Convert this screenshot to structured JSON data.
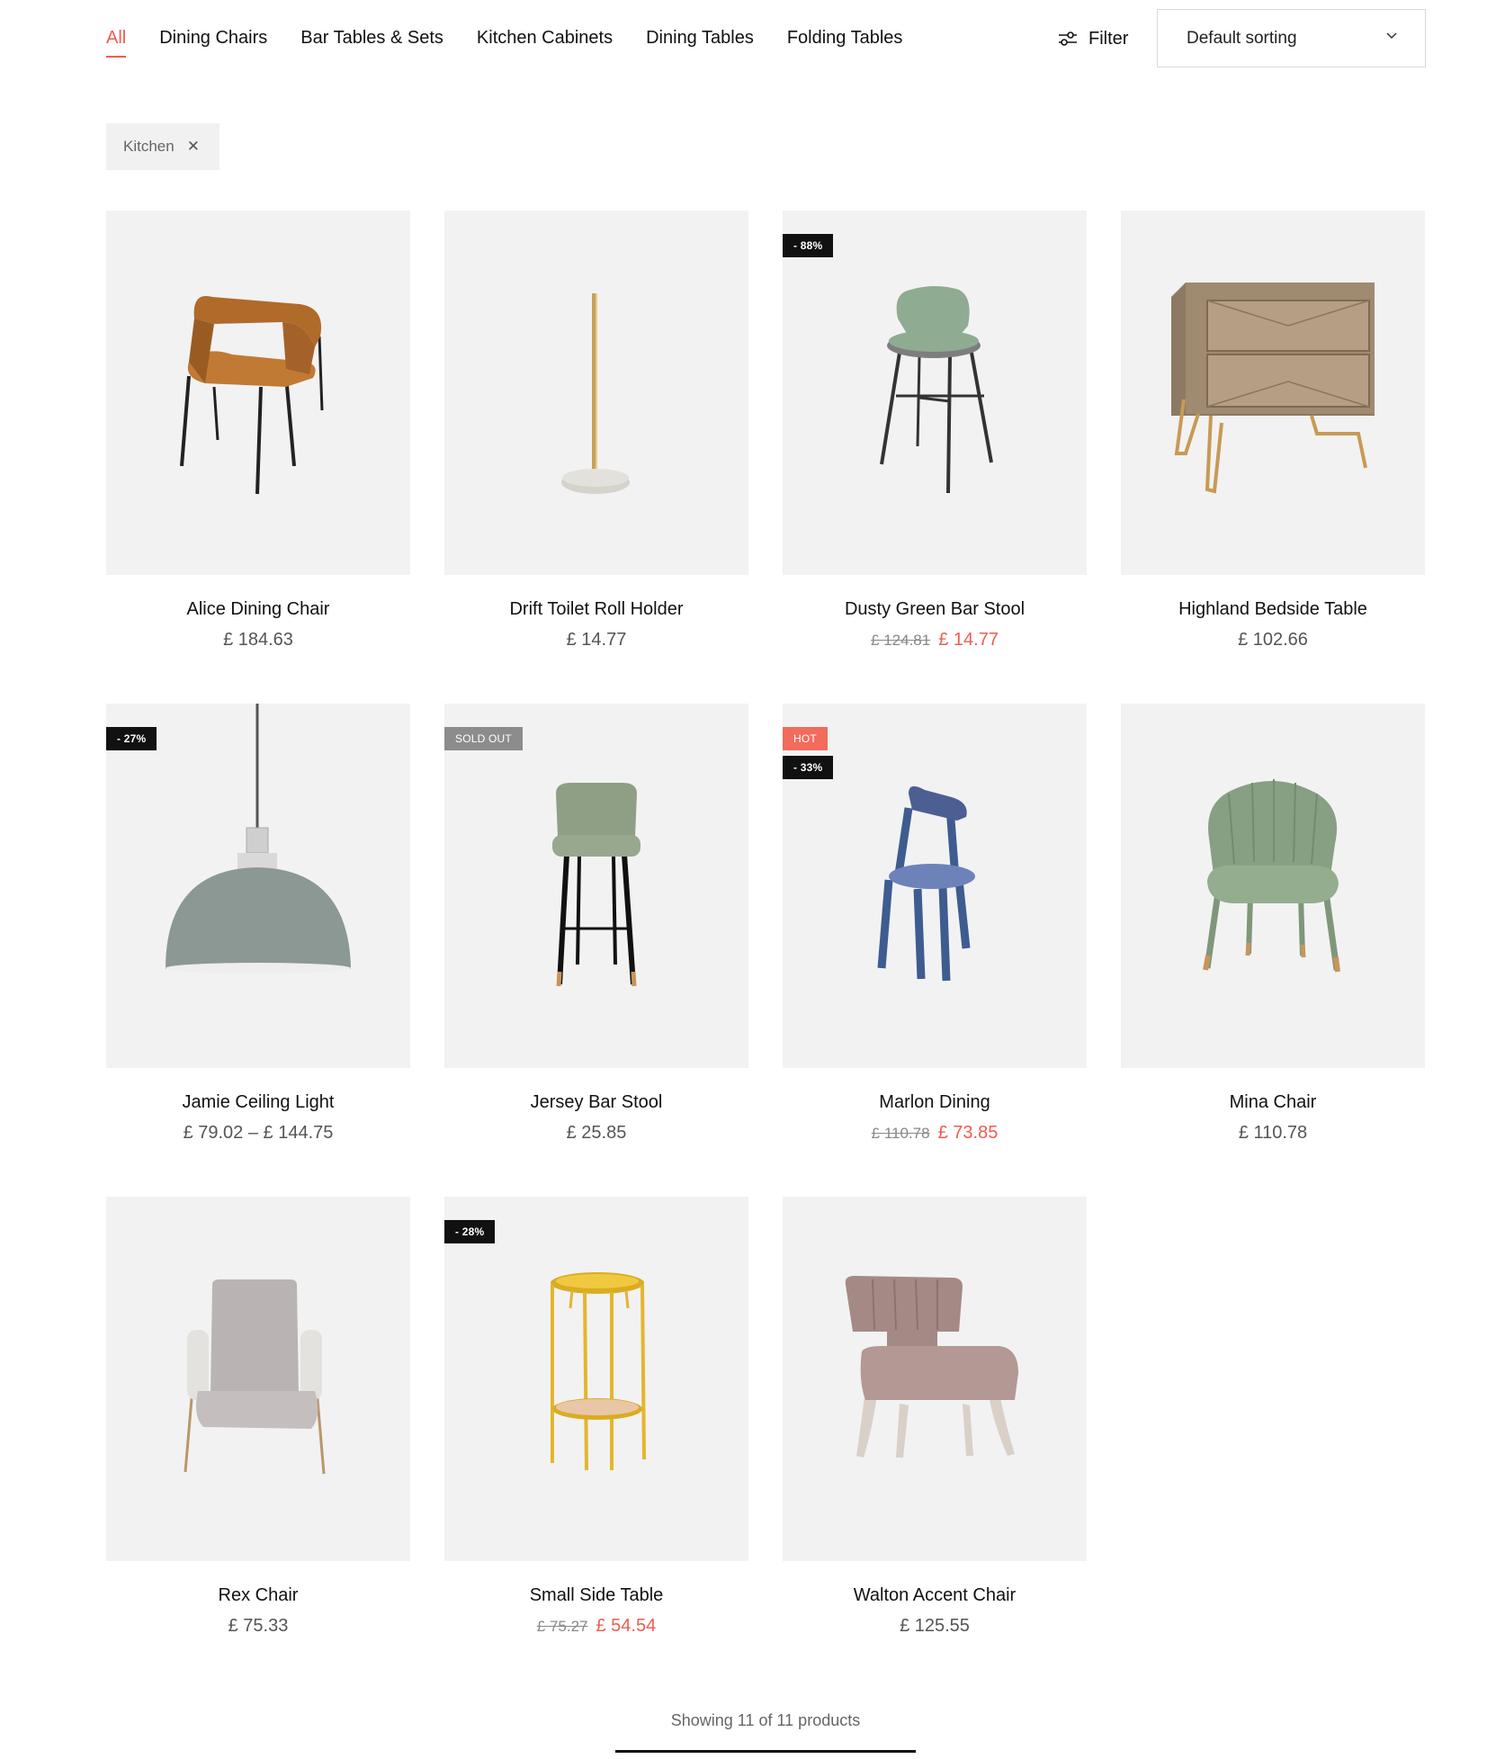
{
  "categories": [
    {
      "label": "All",
      "active": true
    },
    {
      "label": "Dining Chairs"
    },
    {
      "label": "Bar Tables & Sets"
    },
    {
      "label": "Kitchen Cabinets"
    },
    {
      "label": "Dining Tables"
    },
    {
      "label": "Folding Tables"
    }
  ],
  "filter_label": "Filter",
  "sorting": {
    "selected": "Default sorting"
  },
  "active_filter": {
    "label": "Kitchen",
    "remove_symbol": "✕"
  },
  "accent_color": "#ee5d4f",
  "products": [
    {
      "name": "Alice Dining Chair",
      "price": "£ 184.63",
      "icon": "dining-chair-image"
    },
    {
      "name": "Drift Toilet Roll Holder",
      "price": "£ 14.77",
      "icon": "roll-holder-image"
    },
    {
      "name": "Dusty Green Bar Stool",
      "old_price": "£ 124.81",
      "price": "£ 14.77",
      "badges": [
        "- 88%"
      ],
      "icon": "bar-stool-image"
    },
    {
      "name": "Highland Bedside Table",
      "price": "£ 102.66",
      "icon": "bedside-table-image"
    },
    {
      "name": "Jamie Ceiling Light",
      "price": "£ 79.02 – £ 144.75",
      "badges": [
        "- 27%"
      ],
      "icon": "ceiling-light-image"
    },
    {
      "name": "Jersey Bar Stool",
      "price": "£ 25.85",
      "badges": [
        "SOLD OUT"
      ],
      "icon": "bar-stool-image"
    },
    {
      "name": "Marlon Dining",
      "old_price": "£ 110.78",
      "price": "£ 73.85",
      "badges": [
        "HOT",
        "- 33%"
      ],
      "icon": "dining-chair-image"
    },
    {
      "name": "Mina Chair",
      "price": "£ 110.78",
      "icon": "armchair-image"
    },
    {
      "name": "Rex Chair",
      "price": "£ 75.33",
      "icon": "armchair-image"
    },
    {
      "name": "Small Side Table",
      "old_price": "£ 75.27",
      "price": "£ 54.54",
      "badges": [
        "- 28%"
      ],
      "icon": "side-table-image"
    },
    {
      "name": "Walton Accent Chair",
      "price": "£ 125.55",
      "icon": "accent-chair-image"
    }
  ],
  "results_count": "Showing 11 of 11 products"
}
